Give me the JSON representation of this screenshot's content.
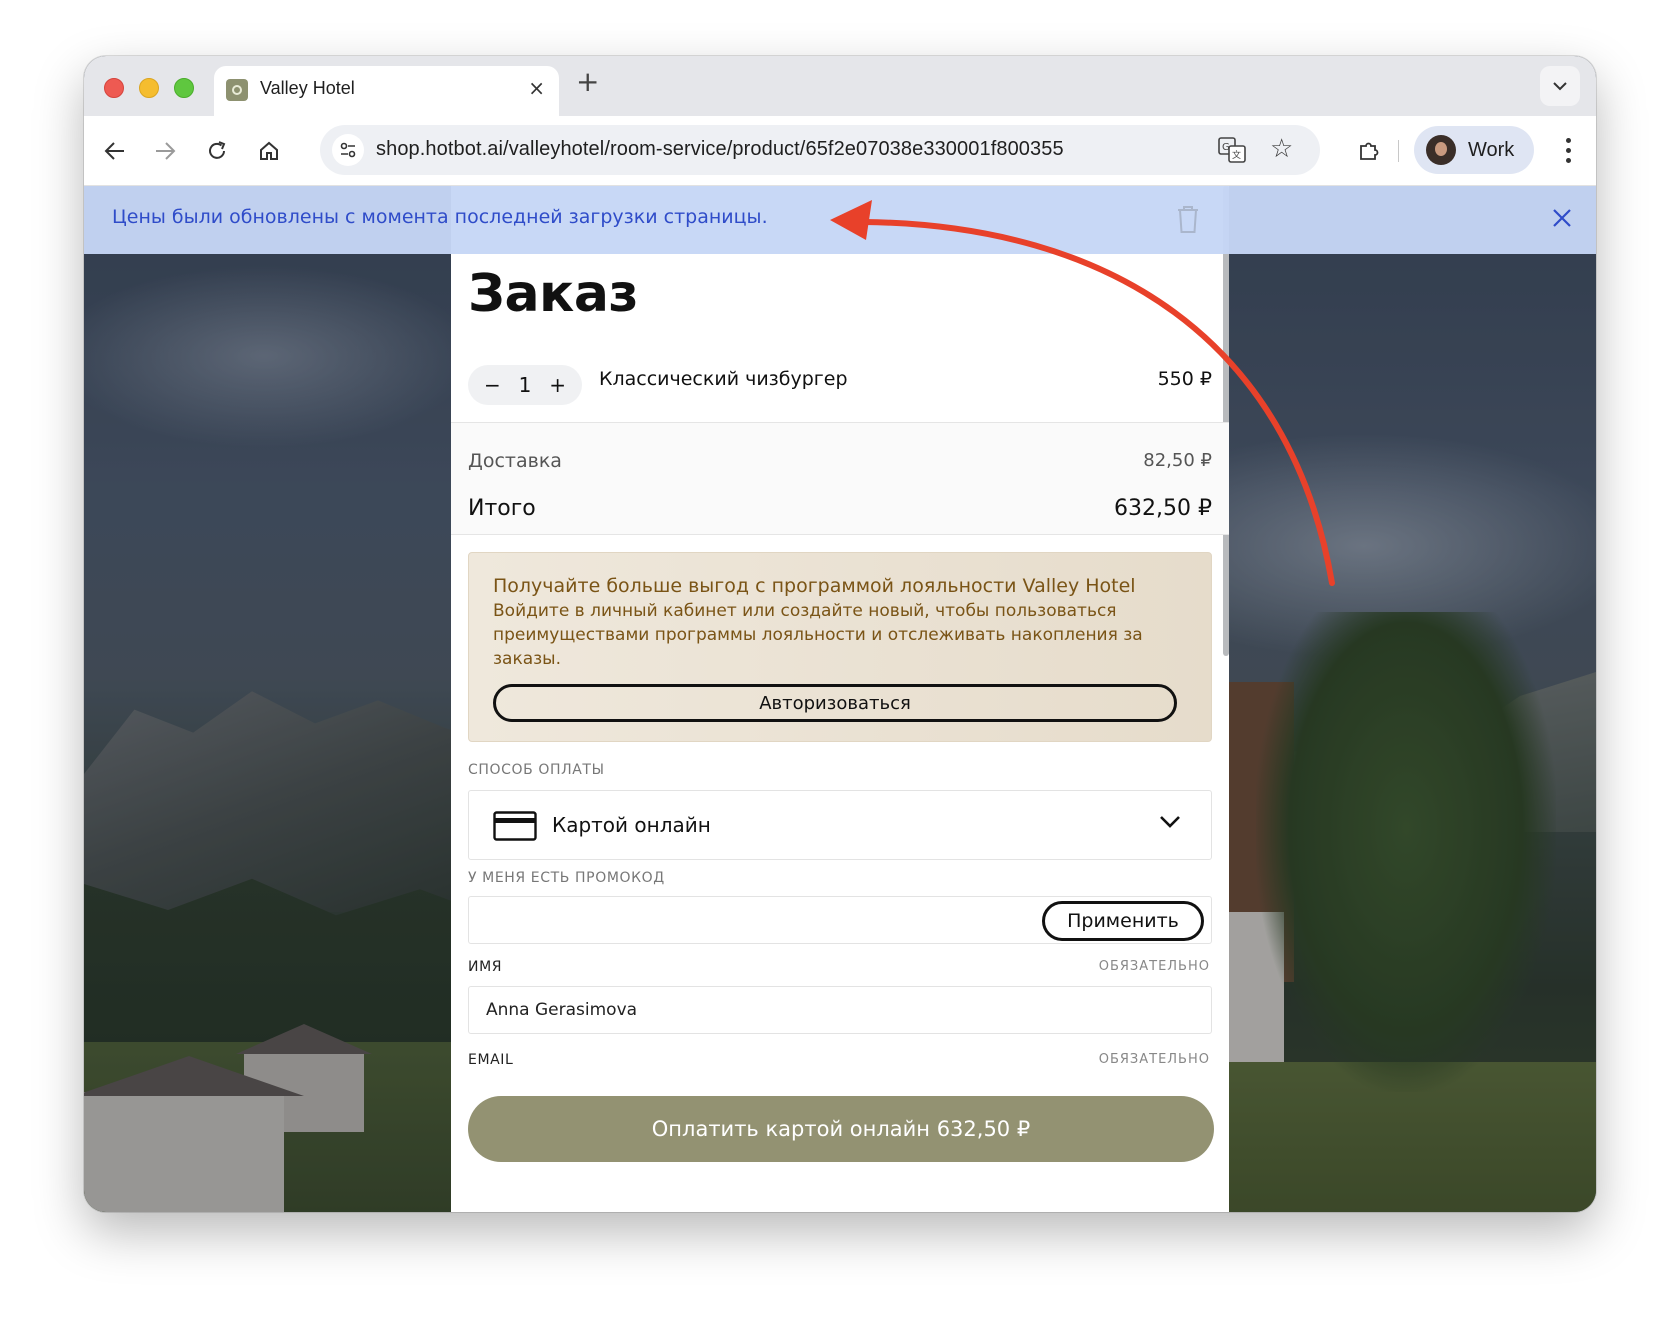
{
  "browser": {
    "tab_title": "Valley Hotel",
    "tab_close": "×",
    "new_tab": "+",
    "url": "shop.hotbot.ai/valleyhotel/room-service/product/65f2e07038e330001f800355",
    "profile_label": "Work"
  },
  "notice": {
    "text": "Цены были обновлены с момента последней загрузки страницы."
  },
  "order": {
    "title": "Заказ",
    "item": {
      "minus": "−",
      "quantity": "1",
      "plus": "+",
      "name": "Классический чизбургер",
      "price": "550 ₽"
    },
    "delivery_label": "Доставка",
    "delivery_value": "82,50 ₽",
    "total_label": "Итого",
    "total_value": "632,50 ₽"
  },
  "loyalty": {
    "title": "Получайте больше выгод с программой лояльности Valley Hotel",
    "text": "Войдите в личный кабинет или создайте новый, чтобы пользоваться преимуществами программы лояльности и отслеживать накопления за заказы.",
    "button": "Авторизоваться"
  },
  "payment": {
    "label": "Способ оплаты",
    "value": "Картой онлайн"
  },
  "promo": {
    "label": "У меня есть промокод",
    "value": "",
    "button": "Применить"
  },
  "name_field": {
    "label": "Имя",
    "required": "Обязательно",
    "value": "Anna Gerasimova"
  },
  "email_field": {
    "label": "EMAIL",
    "required": "Обязательно"
  },
  "pay_button": "Оплатить картой онлайн 632,50 ₽",
  "colors": {
    "notice_bg": "#c6d6f6",
    "notice_text": "#2f4cc9",
    "pay_button": "#939272",
    "loyalty_text": "#7a5416",
    "annotation_arrow": "#e8412a"
  }
}
